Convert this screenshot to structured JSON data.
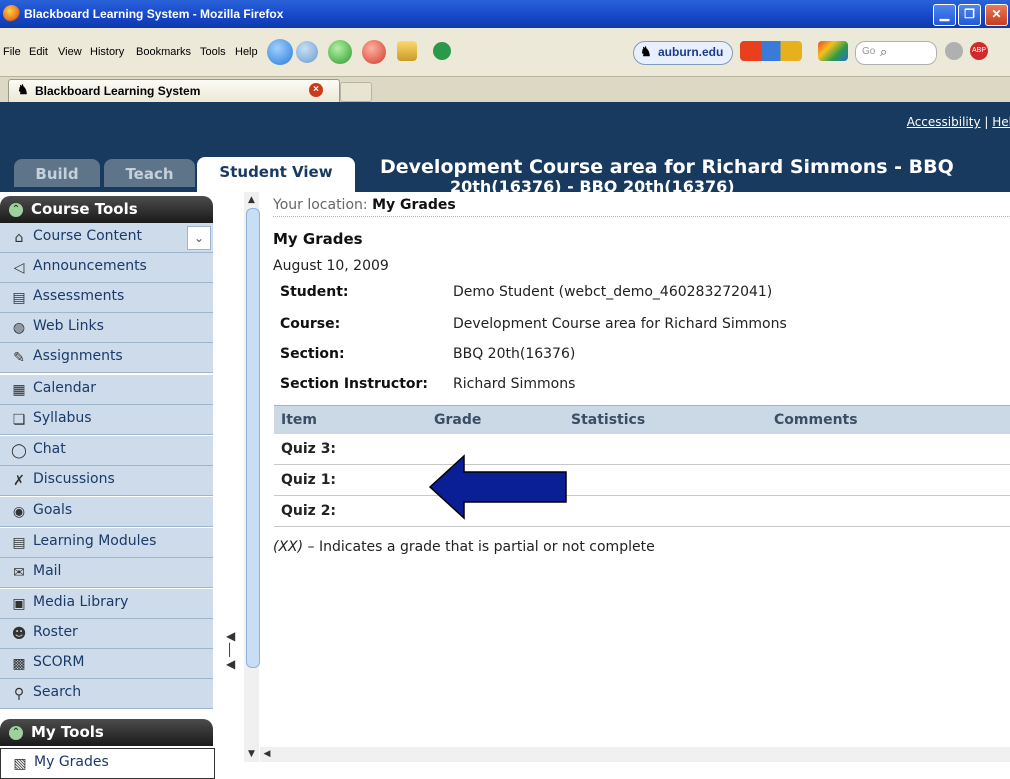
{
  "window": {
    "title": "Blackboard Learning System - Mozilla Firefox",
    "minimize": "▁",
    "maximize": "❐",
    "close": "✕"
  },
  "menubar": {
    "items": [
      "File",
      "Edit",
      "View",
      "History",
      "Bookmarks",
      "Tools",
      "Help"
    ],
    "url_text": "auburn.edu",
    "search_placeholder": "Go"
  },
  "tab": {
    "title": "Blackboard Learning System",
    "close": "×"
  },
  "banner": {
    "links": [
      "Accessibility",
      "|",
      "Hel"
    ],
    "tabs": [
      "Build",
      "Teach",
      "Student View"
    ],
    "course_title": "Development Course area for Richard Simmons - BBQ",
    "course_title_line2": "20th(16376) - BBQ 20th(16376)"
  },
  "sidebar": {
    "course_tools_title": "Course Tools",
    "items": [
      {
        "label": "Course Content",
        "icon": "house-icon"
      },
      {
        "label": "Announcements",
        "icon": "megaphone-icon"
      },
      {
        "label": "Assessments",
        "icon": "clipboard-icon"
      },
      {
        "label": "Web Links",
        "icon": "globe-icon"
      },
      {
        "label": "Assignments",
        "icon": "pencil-paper-icon"
      },
      {
        "label": "Calendar",
        "icon": "calendar-icon"
      },
      {
        "label": "Syllabus",
        "icon": "syllabus-icon"
      },
      {
        "label": "Chat",
        "icon": "chat-bubble-icon"
      },
      {
        "label": "Discussions",
        "icon": "pin-icon"
      },
      {
        "label": "Goals",
        "icon": "goal-icon"
      },
      {
        "label": "Learning Modules",
        "icon": "document-icon"
      },
      {
        "label": "Mail",
        "icon": "envelope-icon"
      },
      {
        "label": "Media Library",
        "icon": "media-icon"
      },
      {
        "label": "Roster",
        "icon": "people-icon"
      },
      {
        "label": "SCORM",
        "icon": "scorm-icon"
      },
      {
        "label": "Search",
        "icon": "magnifier-icon"
      }
    ],
    "my_tools_title": "My Tools",
    "my_tools_items": [
      {
        "label": "My Grades",
        "icon": "grades-icon"
      }
    ]
  },
  "content": {
    "location_prefix": "Your location:",
    "location": "My Grades",
    "title": "My Grades",
    "date": "August 10, 2009",
    "info": [
      {
        "label": "Student:",
        "value": "Demo Student (webct_demo_460283272041)"
      },
      {
        "label": "Course:",
        "value": "Development Course area for Richard Simmons"
      },
      {
        "label": "Section:",
        "value": "BBQ 20th(16376)"
      },
      {
        "label": "Section Instructor:",
        "value": "Richard Simmons"
      }
    ],
    "table_headers": [
      "Item",
      "Grade",
      "Statistics",
      "Comments"
    ],
    "rows": [
      "Quiz 3:",
      "Quiz 1:",
      "Quiz 2:"
    ],
    "note_xx": "(XX)",
    "note_rest": " – Indicates a grade that is partial or not complete"
  },
  "colors": {
    "banner": "#193a5f",
    "nav_bg": "#cddbea",
    "arrow": "#0a1e96"
  }
}
